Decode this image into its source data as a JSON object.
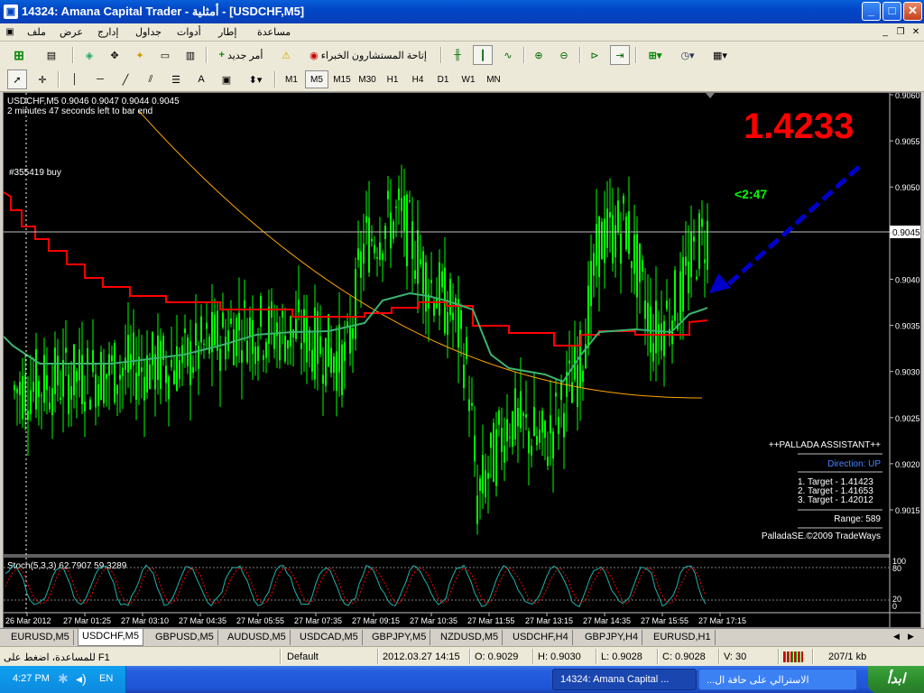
{
  "window": {
    "title": "14324: Amana Capital Trader - أمثلية - [USDCHF,M5]"
  },
  "menu": {
    "items": [
      "ملف",
      "عرض",
      "إدارج",
      "جداول",
      "أدوات",
      "إطار",
      "مساعدة"
    ]
  },
  "toolbar1": {
    "new_order": "أمر جديد",
    "expert_advisors": "إتاحة المستشارون الخبراء"
  },
  "timeframes": [
    "M1",
    "M5",
    "M15",
    "M30",
    "H1",
    "H4",
    "D1",
    "W1",
    "MN"
  ],
  "selected_timeframe": "M5",
  "chart": {
    "header_line1": "USDCHF,M5  0.9046 0.9047 0.9044 0.9045",
    "header_line2": "2 minutes 47 seconds left to bar end",
    "order_label": "#355419 buy",
    "big_price": "1.4233",
    "countdown": "<2:47",
    "current_price_label": "0.9045",
    "price_axis": [
      "0.9060",
      "0.9055",
      "0.9050",
      "0.9045",
      "0.9040",
      "0.9035",
      "0.9030",
      "0.9025",
      "0.9020",
      "0.9015"
    ],
    "time_axis": [
      "26 Mar 2012",
      "27 Mar 01:25",
      "27 Mar 03:10",
      "27 Mar 04:35",
      "27 Mar 05:55",
      "27 Mar 07:35",
      "27 Mar 09:15",
      "27 Mar 10:35",
      "27 Mar 11:55",
      "27 Mar 13:15",
      "27 Mar 14:35",
      "27 Mar 15:55",
      "27 Mar 17:15"
    ],
    "assistant": {
      "title": "++PALLADA ASSISTANT++",
      "direction": "Direction: UP",
      "target1": "1. Target - 1.41423",
      "target2": "2. Target - 1.41653",
      "target3": "3. Target - 1.42012",
      "range": "Range: 589",
      "footer": "PalladaSE.©2009 TradeWays"
    },
    "stoch": {
      "label": "Stoch(5,3,3) 62.7907 59.3289",
      "levels": [
        "100",
        "80",
        "20",
        "0"
      ]
    },
    "colors": {
      "bull": "#00ff00",
      "ma_red": "#ff0000",
      "ma_green": "#3cb371",
      "ma_orange": "#ffa500",
      "big_price": "#ff0000",
      "countdown": "#00ff00",
      "arrow": "#0000cc"
    }
  },
  "symbol_tabs": [
    "EURUSD,M5",
    "USDCHF,M5",
    "GBPUSD,M5",
    "AUDUSD,M5",
    "USDCAD,M5",
    "GBPJPY,M5",
    "NZDUSD,M5",
    "USDCHF,H4",
    "GBPJPY,H4",
    "EURUSD,H1"
  ],
  "active_tab": "USDCHF,M5",
  "status": {
    "help": "للمساعدة، اضغط على F1",
    "profile": "Default",
    "datetime": "2012.03.27 14:15",
    "open": "O: 0.9029",
    "high": "H: 0.9030",
    "low": "L: 0.9028",
    "close": "C: 0.9028",
    "volume": "V: 30",
    "traffic": "207/1 kb"
  },
  "taskbar": {
    "start": "ابدأ",
    "task1": "14324: Amana Capital ...",
    "task2": "...الاسترالي على حافة ال",
    "clock": "4:27 PM",
    "lang": "EN"
  }
}
